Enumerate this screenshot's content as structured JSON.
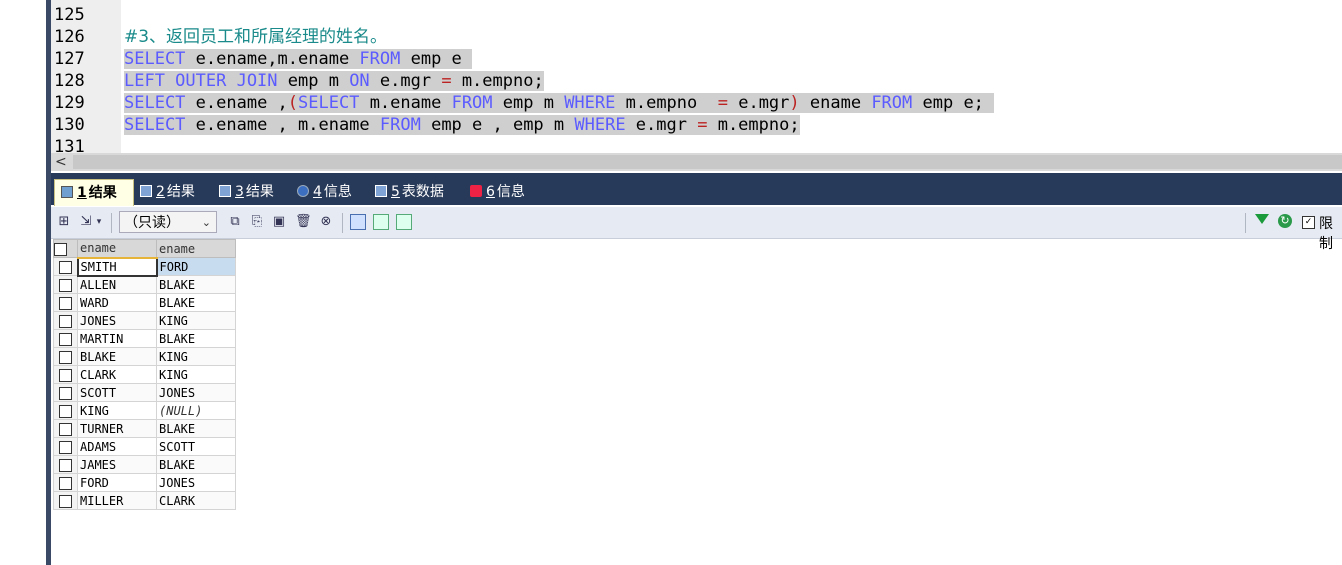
{
  "editor": {
    "lines": [
      {
        "num": "125"
      },
      {
        "num": "126",
        "comment": "#3、返回员工和所属经理的姓名。"
      },
      {
        "num": "127",
        "parts": [
          [
            "kw",
            "SELECT"
          ],
          [
            "t",
            " e.ename,m.ename "
          ],
          [
            "kw",
            "FROM"
          ],
          [
            "t",
            " emp e "
          ]
        ]
      },
      {
        "num": "128",
        "parts": [
          [
            "kw",
            "LEFT OUTER JOIN"
          ],
          [
            "t",
            " emp m "
          ],
          [
            "kw",
            "ON"
          ],
          [
            "t",
            " e.mgr "
          ],
          [
            "op",
            "="
          ],
          [
            "t",
            " m.empno;"
          ]
        ]
      },
      {
        "num": "129",
        "parts": [
          [
            "kw",
            "SELECT"
          ],
          [
            "t",
            " e.ename ,"
          ],
          [
            "op",
            "("
          ],
          [
            "kw",
            "SELECT"
          ],
          [
            "t",
            " m.ename "
          ],
          [
            "kw",
            "FROM"
          ],
          [
            "t",
            " emp m "
          ],
          [
            "kw",
            "WHERE"
          ],
          [
            "t",
            " m.empno  "
          ],
          [
            "op",
            "="
          ],
          [
            "t",
            " e.mgr"
          ],
          [
            "op",
            ")"
          ],
          [
            "t",
            " ename "
          ],
          [
            "kw",
            "FROM"
          ],
          [
            "t",
            " emp e; "
          ]
        ]
      },
      {
        "num": "130",
        "parts": [
          [
            "kw",
            "SELECT"
          ],
          [
            "t",
            " e.ename , m.ename "
          ],
          [
            "kw",
            "FROM"
          ],
          [
            "t",
            " emp e , emp m "
          ],
          [
            "kw",
            "WHERE"
          ],
          [
            "t",
            " e.mgr "
          ],
          [
            "op",
            "="
          ],
          [
            "t",
            " m.empno;"
          ]
        ]
      },
      {
        "num": "131"
      }
    ],
    "scroll_left_arrow": "<"
  },
  "tabs": [
    {
      "num": "1",
      "label": "结果",
      "active": true,
      "icon": "table-icon"
    },
    {
      "num": "2",
      "label": "结果",
      "active": false,
      "icon": "table-icon"
    },
    {
      "num": "3",
      "label": "结果",
      "active": false,
      "icon": "table-icon"
    },
    {
      "num": "4",
      "label": "信息",
      "active": false,
      "icon": "info-icon"
    },
    {
      "num": "5",
      "label": "表数据",
      "active": false,
      "icon": "table-icon"
    },
    {
      "num": "6",
      "label": "信息",
      "active": false,
      "icon": "info-icon"
    }
  ],
  "toolbar": {
    "readonly_label": "（只读）",
    "limit_label": "限制"
  },
  "grid": {
    "columns": [
      "ename",
      "ename"
    ],
    "rows": [
      [
        "SMITH",
        "FORD"
      ],
      [
        "ALLEN",
        "BLAKE"
      ],
      [
        "WARD",
        "BLAKE"
      ],
      [
        "JONES",
        "KING"
      ],
      [
        "MARTIN",
        "BLAKE"
      ],
      [
        "BLAKE",
        "KING"
      ],
      [
        "CLARK",
        "KING"
      ],
      [
        "SCOTT",
        "JONES"
      ],
      [
        "KING",
        "(NULL)"
      ],
      [
        "TURNER",
        "BLAKE"
      ],
      [
        "ADAMS",
        "SCOTT"
      ],
      [
        "JAMES",
        "BLAKE"
      ],
      [
        "FORD",
        "JONES"
      ],
      [
        "MILLER",
        "CLARK"
      ]
    ]
  }
}
